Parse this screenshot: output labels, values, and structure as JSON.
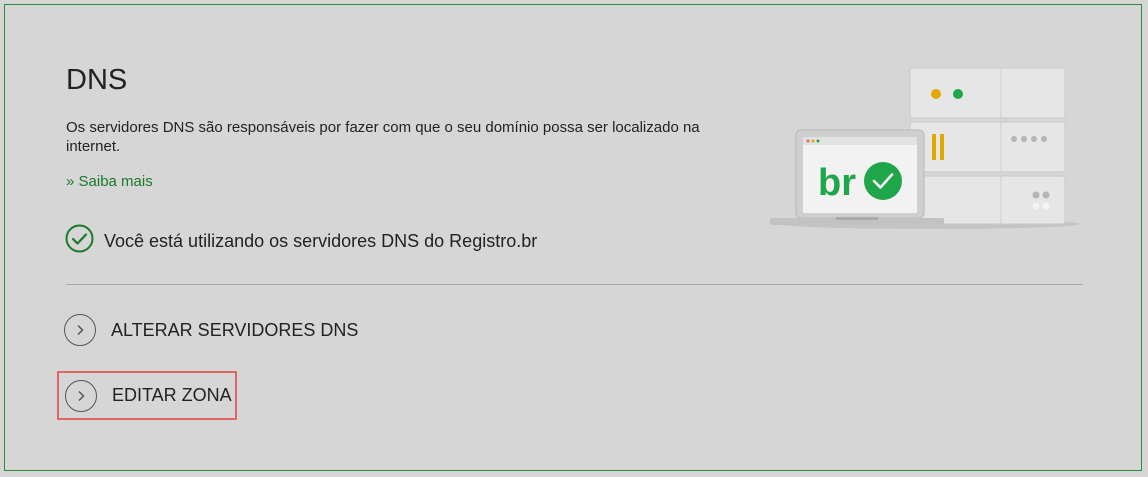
{
  "section": {
    "title": "DNS",
    "description": "Os servidores DNS são responsáveis por fazer com que o seu domínio possa ser localizado na internet.",
    "learn_more": "» Saiba mais",
    "status_text": "Você está utilizando os servidores DNS do Registro.br"
  },
  "actions": [
    {
      "label": "ALTERAR SERVIDORES DNS"
    },
    {
      "label": "EDITAR ZONA"
    }
  ],
  "illustration": {
    "logo_text": "br"
  },
  "colors": {
    "accent_green": "#1a7a2a",
    "highlight_border": "#e06666",
    "check_green": "#1fa64a",
    "amber": "#e0a800"
  },
  "icons": {
    "status": "check-circle-icon",
    "action": "chevron-right-icon"
  }
}
